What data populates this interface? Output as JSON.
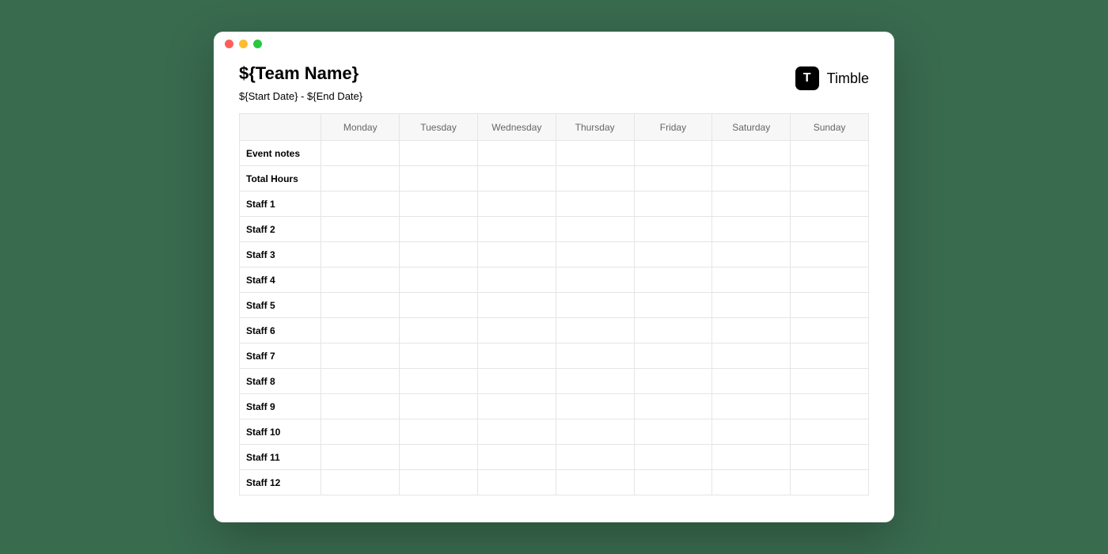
{
  "header": {
    "team_name": "${Team Name}",
    "date_range": "${Start Date} - ${End Date}"
  },
  "brand": {
    "logo_letter": "T",
    "name": "Timble"
  },
  "table": {
    "columns": [
      "Monday",
      "Tuesday",
      "Wednesday",
      "Thursday",
      "Friday",
      "Saturday",
      "Sunday"
    ],
    "rows": [
      "Event notes",
      "Total Hours",
      "Staff 1",
      "Staff 2",
      "Staff 3",
      "Staff 4",
      "Staff 5",
      "Staff 6",
      "Staff 7",
      "Staff 8",
      "Staff 9",
      "Staff 10",
      "Staff 11",
      "Staff 12"
    ]
  }
}
